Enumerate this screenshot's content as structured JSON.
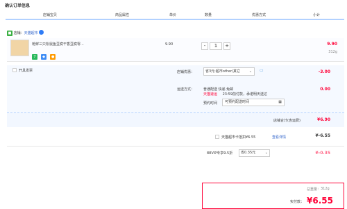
{
  "page_title": "确认订单信息",
  "headers": [
    "店铺宝贝",
    "商品属性",
    "单价",
    "数量",
    "优惠方式",
    "小计"
  ],
  "shop": {
    "label": "店铺：",
    "name": "天猫超市"
  },
  "item": {
    "name": "枪鲜三只松鼠鱼豆腐干香豆腐零...",
    "price": "9.90",
    "quantity": "1",
    "subtotal": "9.90",
    "weight": "312g",
    "minus": "-",
    "plus": "+"
  },
  "invoice": {
    "label": "开具发票"
  },
  "discount": {
    "label": "店铺优惠：",
    "option": "省3元:超市other/其它",
    "value": "-3.00"
  },
  "delivery": {
    "label": "运送方式：",
    "method": "普通配送 快递 免邮",
    "badge": "天猫速运",
    "note": "23:59前付款，承诺明天送达",
    "time_label": "预约时间",
    "time_placeholder": "可预约配送时间",
    "value": "0.00"
  },
  "store_total": {
    "label": "店铺合计(含运费)",
    "value": "¥6.90"
  },
  "points": {
    "label": "天猫超市卡抵扣¥6.55",
    "link": "查看详情",
    "value": "¥-6.55"
  },
  "vip": {
    "label": "88VIP专享9.5折",
    "option": "省0.35元",
    "value": "¥-0.35"
  },
  "summary": {
    "weight_label": "总重量：",
    "weight": "312g",
    "paid_label": "实付款：",
    "paid": "¥6.55"
  },
  "colors": {
    "accent": "#ff0036",
    "link": "#3366cc",
    "border": "#e6e6e6"
  }
}
